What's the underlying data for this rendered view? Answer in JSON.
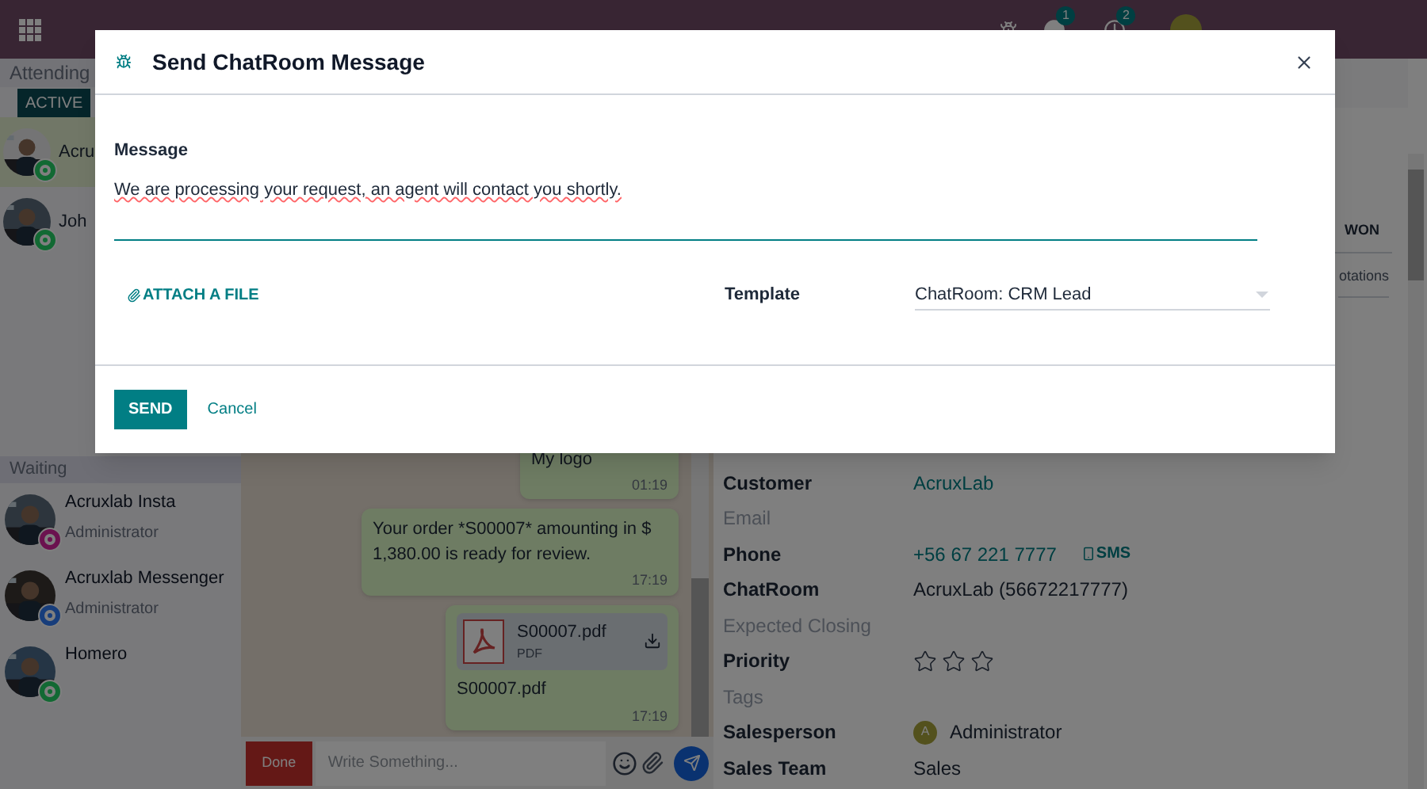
{
  "navbar": {
    "badges": [
      "1",
      "2"
    ]
  },
  "attending": {
    "title": "Attending",
    "tabs": [
      {
        "label": "ACTIVE",
        "selected": true
      }
    ],
    "conversations": [
      {
        "name": "Acru",
        "kind": "whatsapp",
        "selected": true
      },
      {
        "name": "Joh",
        "kind": "whatsapp",
        "selected": false
      }
    ]
  },
  "waiting": {
    "title": "Waiting",
    "conversations": [
      {
        "name": "Acruxlab Insta",
        "agent": "Administrator",
        "kind": "instagram"
      },
      {
        "name": "Acruxlab Messenger",
        "agent": "Administrator",
        "kind": "messenger"
      },
      {
        "name": "Homero",
        "kind": "whatsapp"
      }
    ]
  },
  "messages": [
    {
      "kind": "text",
      "text": "My logo",
      "time": "01:19"
    },
    {
      "kind": "text",
      "text": "Your order *S00007* amounting in $ 1,380.00 is ready for review.",
      "time": "17:19"
    },
    {
      "kind": "file",
      "file_name": "S00007.pdf",
      "file_type": "PDF",
      "caption": "S00007.pdf",
      "time": "17:19"
    }
  ],
  "composer": {
    "done": "Done",
    "placeholder": "Write Something..."
  },
  "lead": {
    "stage": "WON",
    "tab": "otations",
    "fields": [
      {
        "label": "Customer",
        "kind": "link",
        "value": "AcruxLab"
      },
      {
        "label": "Email",
        "kind": "empty"
      },
      {
        "label": "Phone",
        "kind": "phone",
        "value": "+56 67 221 7777",
        "action": "SMS"
      },
      {
        "label": "ChatRoom",
        "kind": "text",
        "value": "AcruxLab (56672217777)"
      },
      {
        "label": "Expected Closing",
        "kind": "empty"
      },
      {
        "label": "Priority",
        "kind": "stars",
        "stars": 0
      },
      {
        "label": "Tags",
        "kind": "empty"
      },
      {
        "label": "Salesperson",
        "kind": "user",
        "initial": "A",
        "value": "Administrator"
      },
      {
        "label": "Sales Team",
        "kind": "text",
        "value": "Sales"
      }
    ]
  },
  "dialog": {
    "title": "Send ChatRoom Message",
    "message_label": "Message",
    "message": "We are processing your request, an agent will contact you shortly.",
    "attach": "ATTACH A FILE",
    "template_label": "Template",
    "template": "ChatRoom: CRM Lead",
    "send": "SEND",
    "cancel": "Cancel"
  }
}
